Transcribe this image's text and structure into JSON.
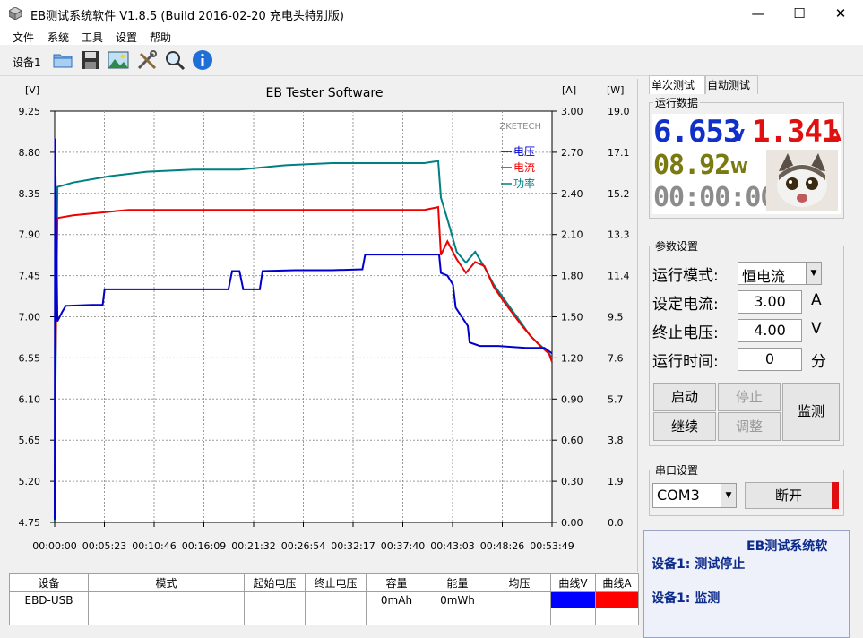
{
  "window": {
    "title": "EB测试系统软件 V1.8.5 (Build 2016-02-20 充电头特别版)",
    "minimize": "—",
    "maximize": "☐",
    "close": "✕"
  },
  "menu": [
    "文件",
    "系统",
    "工具",
    "设置",
    "帮助"
  ],
  "toolbar": {
    "device_label": "设备1",
    "tools": [
      "folder-icon",
      "save-icon",
      "image-icon",
      "tools-icon",
      "search-icon",
      "info-icon"
    ]
  },
  "chart_data": {
    "type": "line",
    "title": "EB Tester Software",
    "watermark": "ZKETECH",
    "axes": {
      "left": {
        "unit": "[V]",
        "min": 4.75,
        "max": 9.25,
        "ticks": [
          "9.25",
          "8.80",
          "8.35",
          "7.90",
          "7.45",
          "7.00",
          "6.55",
          "6.10",
          "5.65",
          "5.20",
          "4.75"
        ]
      },
      "right_a": {
        "unit": "[A]",
        "min": 0,
        "max": 3.0,
        "ticks": [
          "3.00",
          "2.70",
          "2.40",
          "2.10",
          "1.80",
          "1.50",
          "1.20",
          "0.90",
          "0.60",
          "0.30",
          "0.00"
        ]
      },
      "right_w": {
        "unit": "[W]",
        "min": 0,
        "max": 19.0,
        "ticks": [
          "19.0",
          "17.1",
          "15.2",
          "13.3",
          "11.4",
          "9.5",
          "7.6",
          "5.7",
          "3.8",
          "1.9",
          "0.0"
        ]
      },
      "x": {
        "min": 0,
        "max": 53.82,
        "unit": "min",
        "ticks": [
          "00:00:00",
          "00:05:23",
          "00:10:46",
          "00:16:09",
          "00:21:32",
          "00:26:54",
          "00:32:17",
          "00:37:40",
          "00:43:03",
          "00:48:26",
          "00:53:49"
        ]
      }
    },
    "grid": true,
    "legend_position": "top-right",
    "series": [
      {
        "name": "电压",
        "axis": "left",
        "color": "#0000cc",
        "x": [
          0,
          0.05,
          0.3,
          0.8,
          1.2,
          4,
          5.2,
          5.4,
          9,
          12,
          16,
          18.8,
          19.2,
          20,
          20.4,
          22.2,
          22.5,
          26,
          30,
          33.3,
          33.6,
          36,
          40,
          41.6,
          41.8,
          42.5,
          43.1,
          43.4,
          44.7,
          44.9,
          46,
          48,
          51,
          53,
          53.82
        ],
        "y": [
          4.78,
          8.95,
          6.95,
          7.05,
          7.12,
          7.13,
          7.13,
          7.3,
          7.3,
          7.3,
          7.3,
          7.3,
          7.5,
          7.5,
          7.3,
          7.3,
          7.5,
          7.51,
          7.51,
          7.52,
          7.68,
          7.68,
          7.68,
          7.68,
          7.48,
          7.45,
          7.35,
          7.1,
          6.9,
          6.72,
          6.68,
          6.68,
          6.66,
          6.66,
          6.6
        ]
      },
      {
        "name": "电流",
        "axis": "right_a",
        "color": "#ee0000",
        "x": [
          0,
          0.1,
          0.3,
          2,
          5,
          8,
          12,
          16,
          20,
          24,
          28,
          32,
          36,
          40,
          41.5,
          41.8,
          42.5,
          43.5,
          44.5,
          45.5,
          46.5,
          47.5,
          48.5,
          49.5,
          50.5,
          51.5,
          52.5,
          53.5,
          53.82
        ],
        "y": [
          0.05,
          1.2,
          2.22,
          2.24,
          2.26,
          2.28,
          2.28,
          2.28,
          2.28,
          2.28,
          2.28,
          2.28,
          2.28,
          2.28,
          2.3,
          1.95,
          2.05,
          1.92,
          1.82,
          1.9,
          1.87,
          1.72,
          1.62,
          1.53,
          1.44,
          1.36,
          1.29,
          1.23,
          1.17
        ]
      },
      {
        "name": "功率",
        "axis": "right_w",
        "color": "#008080",
        "x": [
          0,
          0.1,
          0.3,
          2,
          6,
          10,
          15,
          20,
          25,
          30,
          35,
          38,
          40,
          41.5,
          41.8,
          42.5,
          43.5,
          44.5,
          45.5,
          46.5,
          47.5,
          48.5,
          49.5,
          50.5,
          51.5,
          52.5,
          53.5,
          53.82
        ],
        "y": [
          0.05,
          6.5,
          15.5,
          15.7,
          16.0,
          16.2,
          16.3,
          16.3,
          16.5,
          16.6,
          16.6,
          16.6,
          16.6,
          16.7,
          15.0,
          14.0,
          12.5,
          12.0,
          12.5,
          11.8,
          11.0,
          10.4,
          9.8,
          9.2,
          8.6,
          8.2,
          7.8,
          7.6
        ]
      }
    ]
  },
  "table": {
    "headers": [
      "设备",
      "模式",
      "起始电压",
      "终止电压",
      "容量",
      "能量",
      "均压",
      "曲线V",
      "曲线A"
    ],
    "row": [
      "EBD-USB",
      "",
      "",
      "",
      "0mAh",
      "0mWh",
      "",
      "",
      ""
    ],
    "curve_colors": [
      "#0000ff",
      "#ff0000"
    ]
  },
  "right": {
    "tabs": [
      "单次测试",
      "自动测试"
    ],
    "run_data_title": "运行数据",
    "voltage": "6.653",
    "voltage_unit": "V",
    "current": "1.341",
    "current_unit": "A",
    "power": "08.92",
    "power_unit": "W",
    "time": "00:00:00",
    "params_title": "参数设置",
    "mode_label": "运行模式:",
    "mode_value": "恒电流",
    "set_current_label": "设定电流:",
    "set_current_value": "3.00",
    "set_current_unit": "A",
    "stop_voltage_label": "终止电压:",
    "stop_voltage_value": "4.00",
    "stop_voltage_unit": "V",
    "run_time_label": "运行时间:",
    "run_time_value": "0",
    "run_time_unit": "分",
    "btn_start": "启动",
    "btn_stop": "停止",
    "btn_continue": "继续",
    "btn_adjust": "调整",
    "btn_monitor": "监测",
    "serial_title": "串口设置",
    "com_value": "COM3",
    "btn_disconnect": "断开"
  },
  "log": {
    "title": "EB测试系统软",
    "line1": "设备1: 测试停止",
    "line2": "设备1: 监测"
  },
  "colors": {
    "voltage_digits": "#1030c8",
    "current_digits": "#e01010",
    "power_digits": "#7a7a10",
    "time_digits": "#8c8c8c",
    "status_red": "#e01010"
  }
}
